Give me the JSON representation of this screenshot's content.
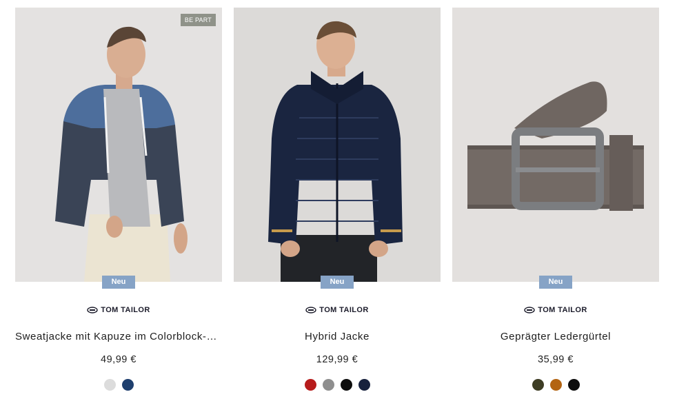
{
  "products": [
    {
      "badge_top": "BE PART",
      "badge": "Neu",
      "brand": "TOM TAILOR",
      "name": "Sweatjacke mit Kapuze im Colorblock-Design",
      "price": "49,99 €",
      "colors": [
        "#dcdcdc",
        "#1f3f6e"
      ]
    },
    {
      "badge": "Neu",
      "brand": "TOM TAILOR",
      "name": "Hybrid Jacke",
      "price": "129,99 €",
      "colors": [
        "#b71c1c",
        "#8f8f8f",
        "#0d0d0d",
        "#17213d"
      ]
    },
    {
      "badge": "Neu",
      "brand": "TOM TAILOR",
      "name": "Geprägter Ledergürtel",
      "price": "35,99 €",
      "colors": [
        "#3e3d24",
        "#b36412",
        "#0d0d0d"
      ]
    }
  ]
}
